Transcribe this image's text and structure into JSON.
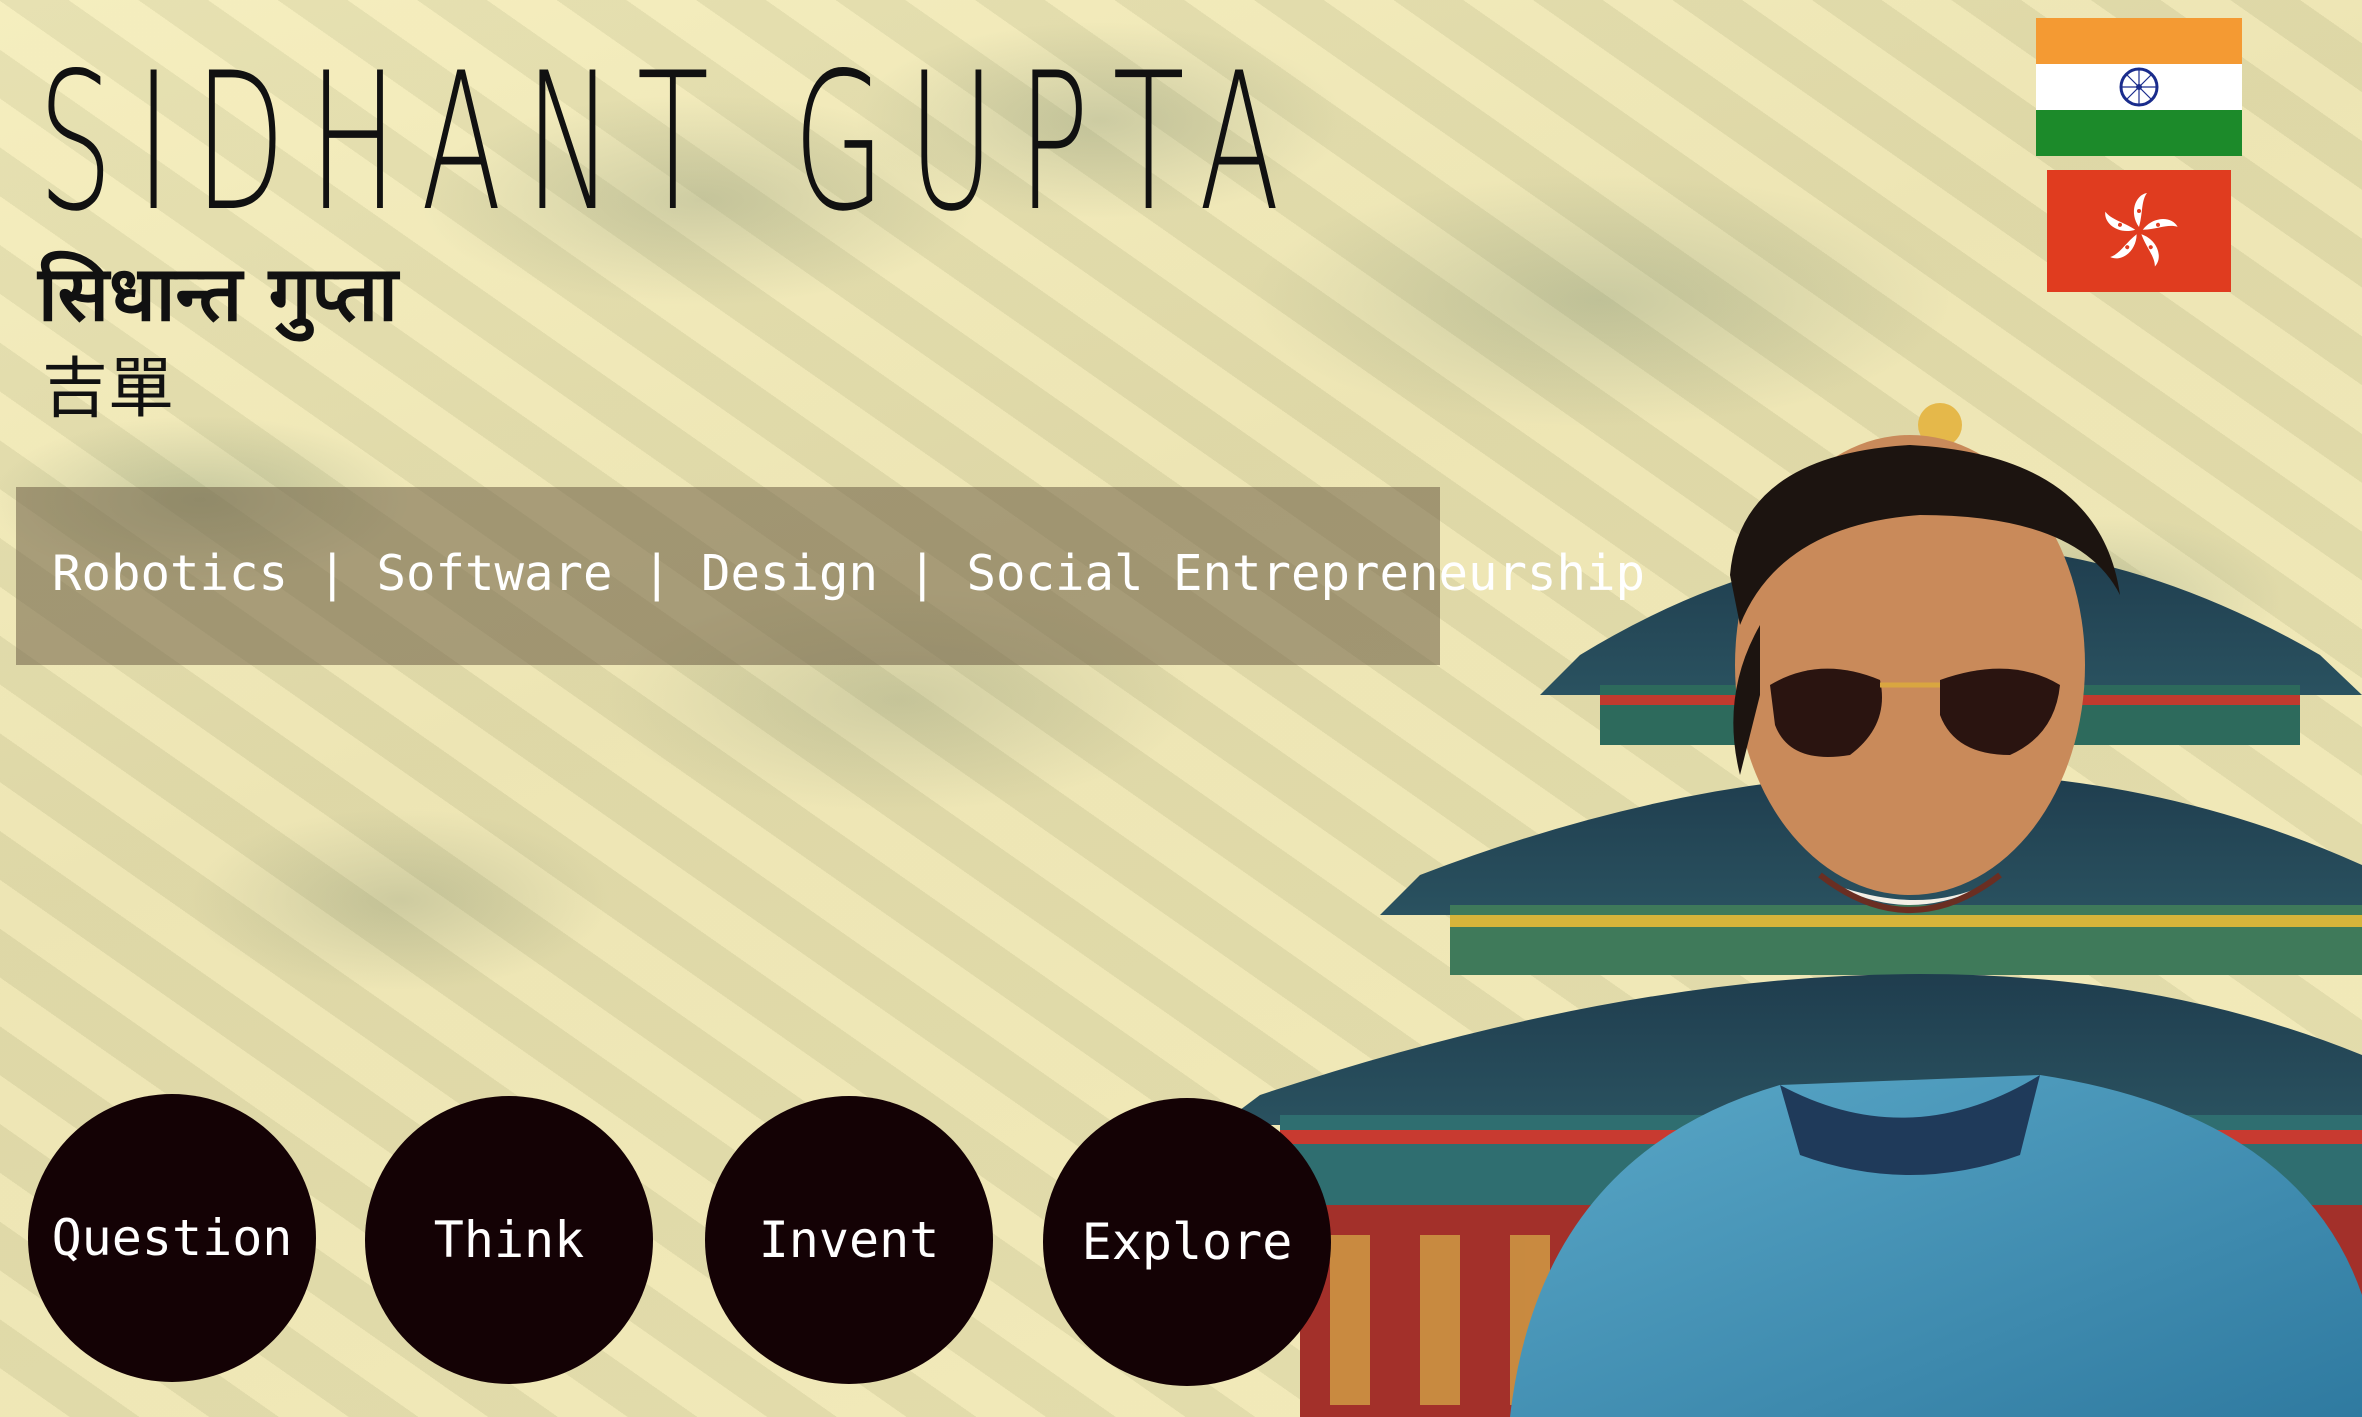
{
  "header": {
    "name": "SIDHANT GUPTA",
    "name_hindi": "सिधान्त गुप्ता",
    "name_chinese": "吉單"
  },
  "tagline": "Robotics | Software | Design | Social Entrepreneurship",
  "flags": [
    "india-flag",
    "hong-kong-flag"
  ],
  "nav": {
    "question": "Question",
    "think": "Think",
    "invent": "Invent",
    "explore": "Explore"
  },
  "photo": "portrait-temple-of-heaven"
}
